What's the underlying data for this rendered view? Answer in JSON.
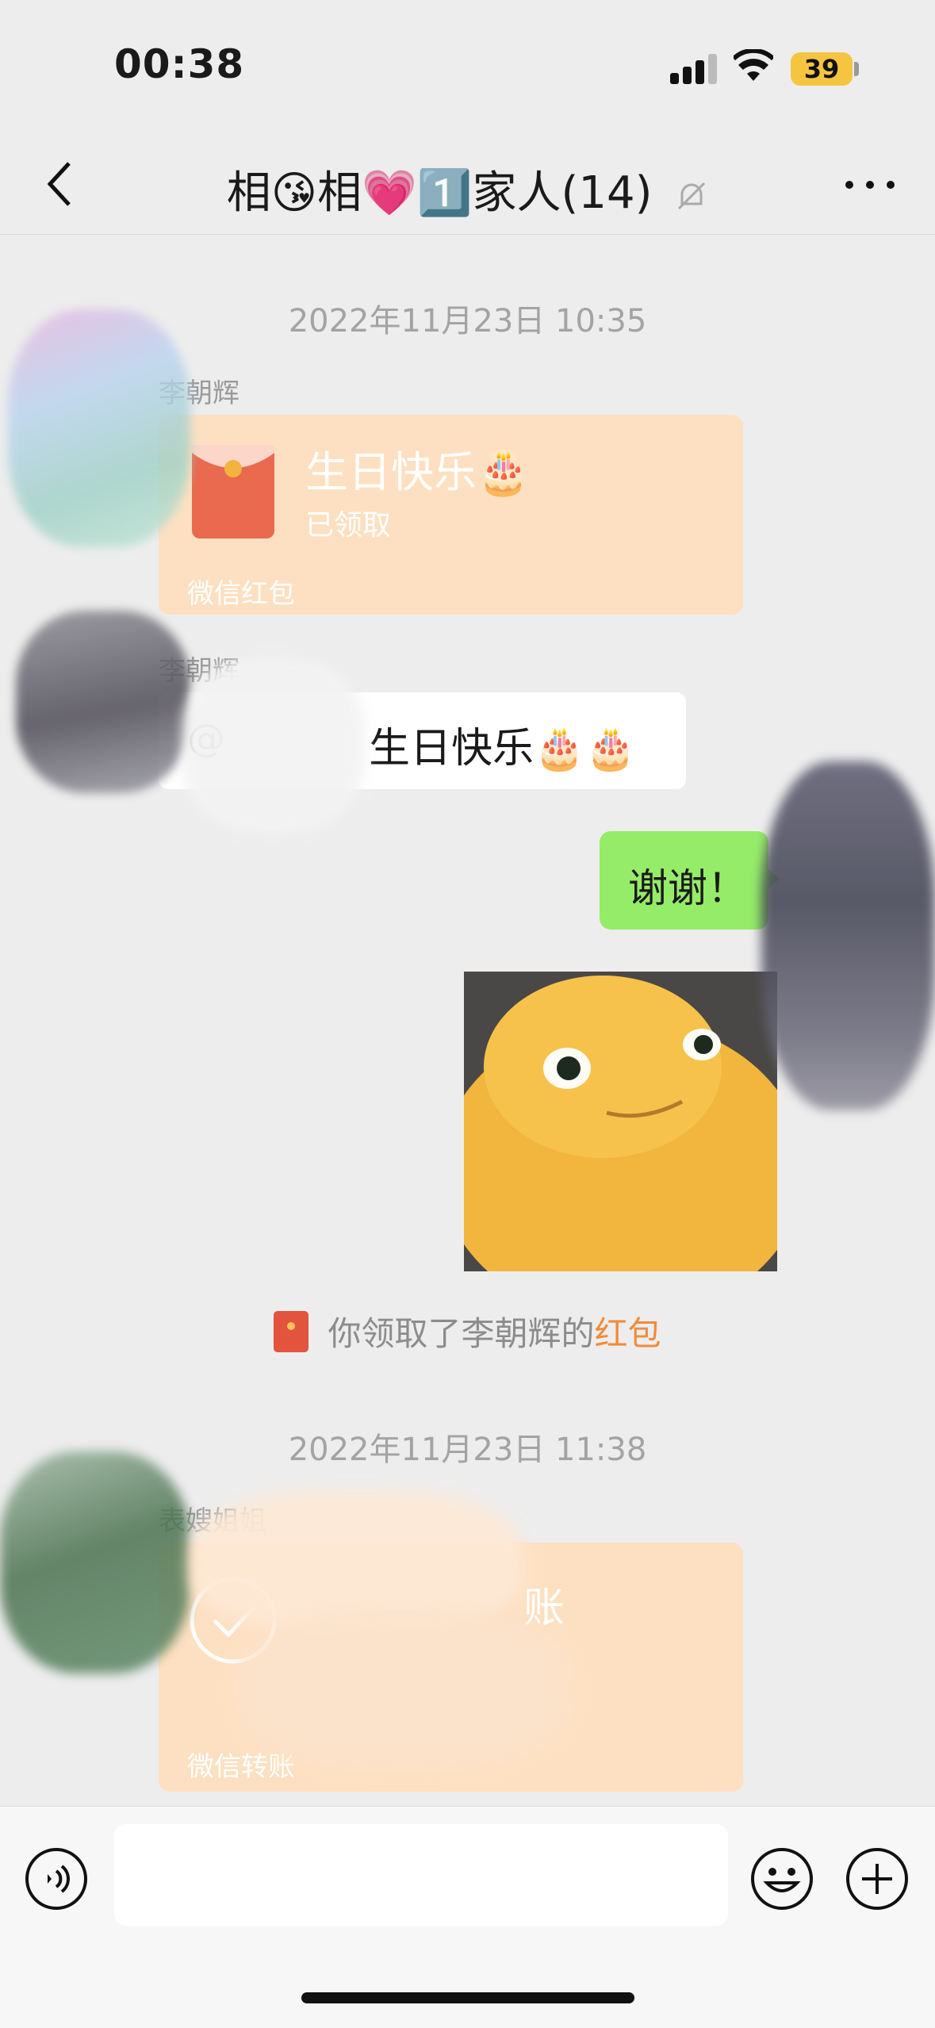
{
  "status_bar": {
    "time": "00:38",
    "battery": "39"
  },
  "nav": {
    "title": "相😘相💗1️⃣家人(14)",
    "muted_icon": "bell-off-icon"
  },
  "messages": {
    "ts1": "2022年11月23日 10:35",
    "red_packet": {
      "sender": "李朝辉",
      "title": "生日快乐🎂",
      "status": "已领取",
      "footer": "微信红包"
    },
    "text_msg": {
      "sender": "李朝辉",
      "prefix": "@",
      "text": "生日快乐🎂🎂"
    },
    "my_reply": "谢谢！",
    "system": {
      "text": "你领取了李朝辉的",
      "link": "红包"
    },
    "ts2": "2022年11月23日 11:38",
    "transfer": {
      "sender": "表嫂姐姐",
      "title": "账",
      "footer": "微信转账"
    }
  },
  "input": {
    "placeholder": ""
  },
  "colors": {
    "my_bubble": "#95ec69",
    "red_packet_bg": "#fde0c1",
    "link": "#f08c3a"
  }
}
